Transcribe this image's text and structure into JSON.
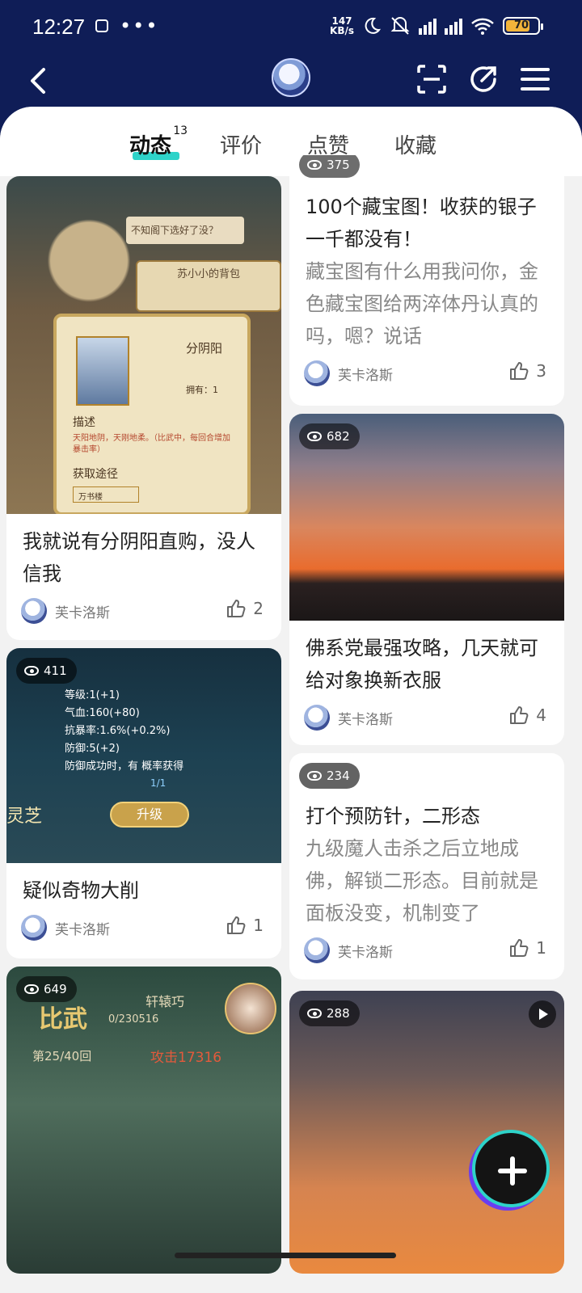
{
  "status": {
    "time": "12:27",
    "dots": "•••",
    "speed_top": "147",
    "speed_bottom": "KB/s",
    "battery": "70"
  },
  "tabs": [
    {
      "label": "动态",
      "count": "13"
    },
    {
      "label": "评价"
    },
    {
      "label": "点赞"
    },
    {
      "label": "收藏"
    }
  ],
  "author": "芙卡洛斯",
  "cards": {
    "c1": {
      "title": "我就说有分阴阳直购，没人信我",
      "likes": "2"
    },
    "c2": {
      "views": "411",
      "title": "疑似奇物大削",
      "likes": "1"
    },
    "c3": {
      "views": "649"
    },
    "c4": {
      "views": "375",
      "title": "100个藏宝图！收获的银子一千都没有！",
      "desc": "藏宝图有什么用我问你，金色藏宝图给两淬体丹认真的吗，嗯？说话",
      "likes": "3"
    },
    "c5": {
      "views": "682",
      "title": "佛系党最强攻略，几天就可给对象换新衣服",
      "likes": "4"
    },
    "c6": {
      "views": "234",
      "title": "打个预防针，二形态",
      "desc": "九级魔人击杀之后立地成佛，解锁二形态。目前就是面板没变，机制变了",
      "likes": "1"
    },
    "c7": {
      "views": "288"
    }
  },
  "game1": {
    "bubble": "不知阁下选好了没？",
    "bag": "苏小小的背包",
    "item": "分阴阳",
    "desc_label": "描述",
    "desc": "天阳地阴，天刚地柔。（比武中，每回合增加暴击率）",
    "source_label": "获取途径",
    "source": "万书楼",
    "own": "拥有：1"
  },
  "game2": {
    "lines": [
      "等级:1(+1)",
      "气血:160(+80)",
      "抗暴率:1.6%(+0.2%)",
      "防御:5(+2)",
      "防御成功时，有 概率获得"
    ],
    "upgrade": "升级",
    "count": "1/1",
    "side": "灵芝"
  },
  "game3": {
    "title": "比武",
    "name": "轩辕巧",
    "round": "第25/40回",
    "atk": "攻击17316",
    "hp": "0/230516"
  }
}
